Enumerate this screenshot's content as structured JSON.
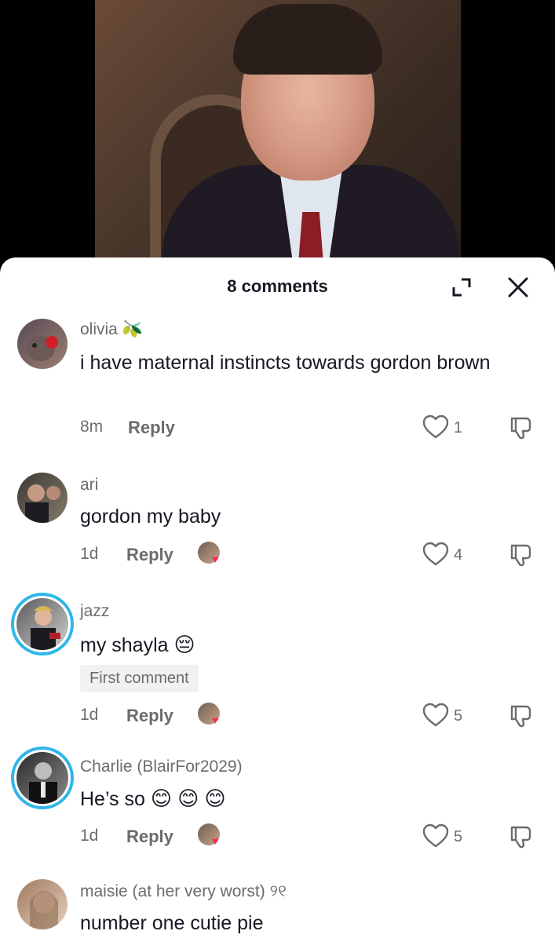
{
  "header": {
    "comment_count_label": "8 comments",
    "expand_icon": "expand-icon",
    "close_icon": "close-icon"
  },
  "comments": [
    {
      "username": "olivia",
      "username_emoji": "🫒",
      "text": "i have maternal instincts towards gordon brown",
      "time": "8m",
      "reply_label": "Reply",
      "likes": "1",
      "creator_liked": false,
      "badge": ""
    },
    {
      "username": "ari",
      "username_emoji": "",
      "text": "gordon my baby",
      "time": "1d",
      "reply_label": "Reply",
      "likes": "4",
      "creator_liked": true,
      "badge": ""
    },
    {
      "username": "jazz",
      "username_emoji": "",
      "text": "my shayla",
      "text_emoji": "😔",
      "time": "1d",
      "reply_label": "Reply",
      "likes": "5",
      "creator_liked": true,
      "badge": "First comment"
    },
    {
      "username": "Charlie (BlairFor2029)",
      "username_emoji": "",
      "text": "He’s so",
      "text_emoji": "😊 😊 😊",
      "time": "1d",
      "reply_label": "Reply",
      "likes": "5",
      "creator_liked": true,
      "badge": ""
    },
    {
      "username": "maisie (at her very worst)",
      "username_emoji": "୨୧",
      "text": "number one cutie pie",
      "time": "",
      "reply_label": "",
      "likes": "",
      "creator_liked": false,
      "badge": ""
    }
  ],
  "colors": {
    "story_ring": "#2fb6e8",
    "heart": "#ff2a55",
    "secondary_text": "#6b6b70",
    "primary_text": "#161823"
  }
}
